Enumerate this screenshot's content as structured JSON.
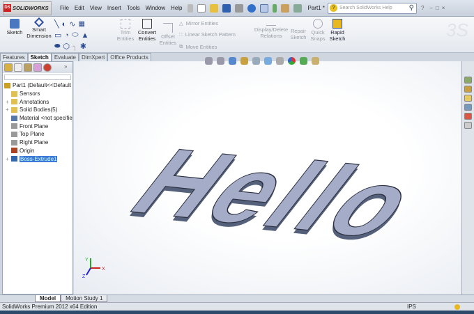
{
  "app": {
    "logo": "SOLIDWORKS",
    "doc_title": "Part1 *"
  },
  "menu": [
    "File",
    "Edit",
    "View",
    "Insert",
    "Tools",
    "Window",
    "Help"
  ],
  "search": {
    "placeholder": "Search SolidWorks Help"
  },
  "ribbon": {
    "sketch": "Sketch",
    "smart_dimension": "Smart Dimension",
    "trim": "Trim Entities",
    "convert": "Convert Entities",
    "offset": "Offset Entities",
    "mirror": "Mirror Entities",
    "linear_pattern": "Linear Sketch Pattern",
    "move": "Move Entities",
    "display_delete": "Display/Delete Relations",
    "repair": "Repair Sketch",
    "quick_snaps": "Quick Snaps",
    "rapid_sketch": "Rapid Sketch"
  },
  "command_tabs": [
    "Features",
    "Sketch",
    "Evaluate",
    "DimXpert",
    "Office Products"
  ],
  "active_tab": "Sketch",
  "tree": [
    {
      "label": "Part1  (Default<<Default",
      "icon": "part-icon",
      "color": "#c9a020"
    },
    {
      "label": "Sensors",
      "icon": "sensors-folder-icon",
      "color": "#e0c050"
    },
    {
      "label": "Annotations",
      "icon": "annotations-folder-icon",
      "color": "#e0c050"
    },
    {
      "label": "Solid Bodies(5)",
      "icon": "solid-bodies-folder-icon",
      "color": "#e0c050"
    },
    {
      "label": "Material <not specified>",
      "icon": "material-icon",
      "color": "#5577aa"
    },
    {
      "label": "Front Plane",
      "icon": "plane-icon",
      "color": "#999999"
    },
    {
      "label": "Top Plane",
      "icon": "plane-icon",
      "color": "#999999"
    },
    {
      "label": "Right Plane",
      "icon": "plane-icon",
      "color": "#999999"
    },
    {
      "label": "Origin",
      "icon": "origin-icon",
      "color": "#aa4422"
    },
    {
      "label": "Boss-Extrude1",
      "icon": "extrude-icon",
      "color": "#3366aa"
    }
  ],
  "model_text": "Hello",
  "bottom_tabs": [
    "Model",
    "Motion Study 1"
  ],
  "status": {
    "text": "SolidWorks Premium 2012 x64 Edition",
    "units": "IPS"
  },
  "triad": {
    "x": "X",
    "y": "Y",
    "z": "Z"
  }
}
